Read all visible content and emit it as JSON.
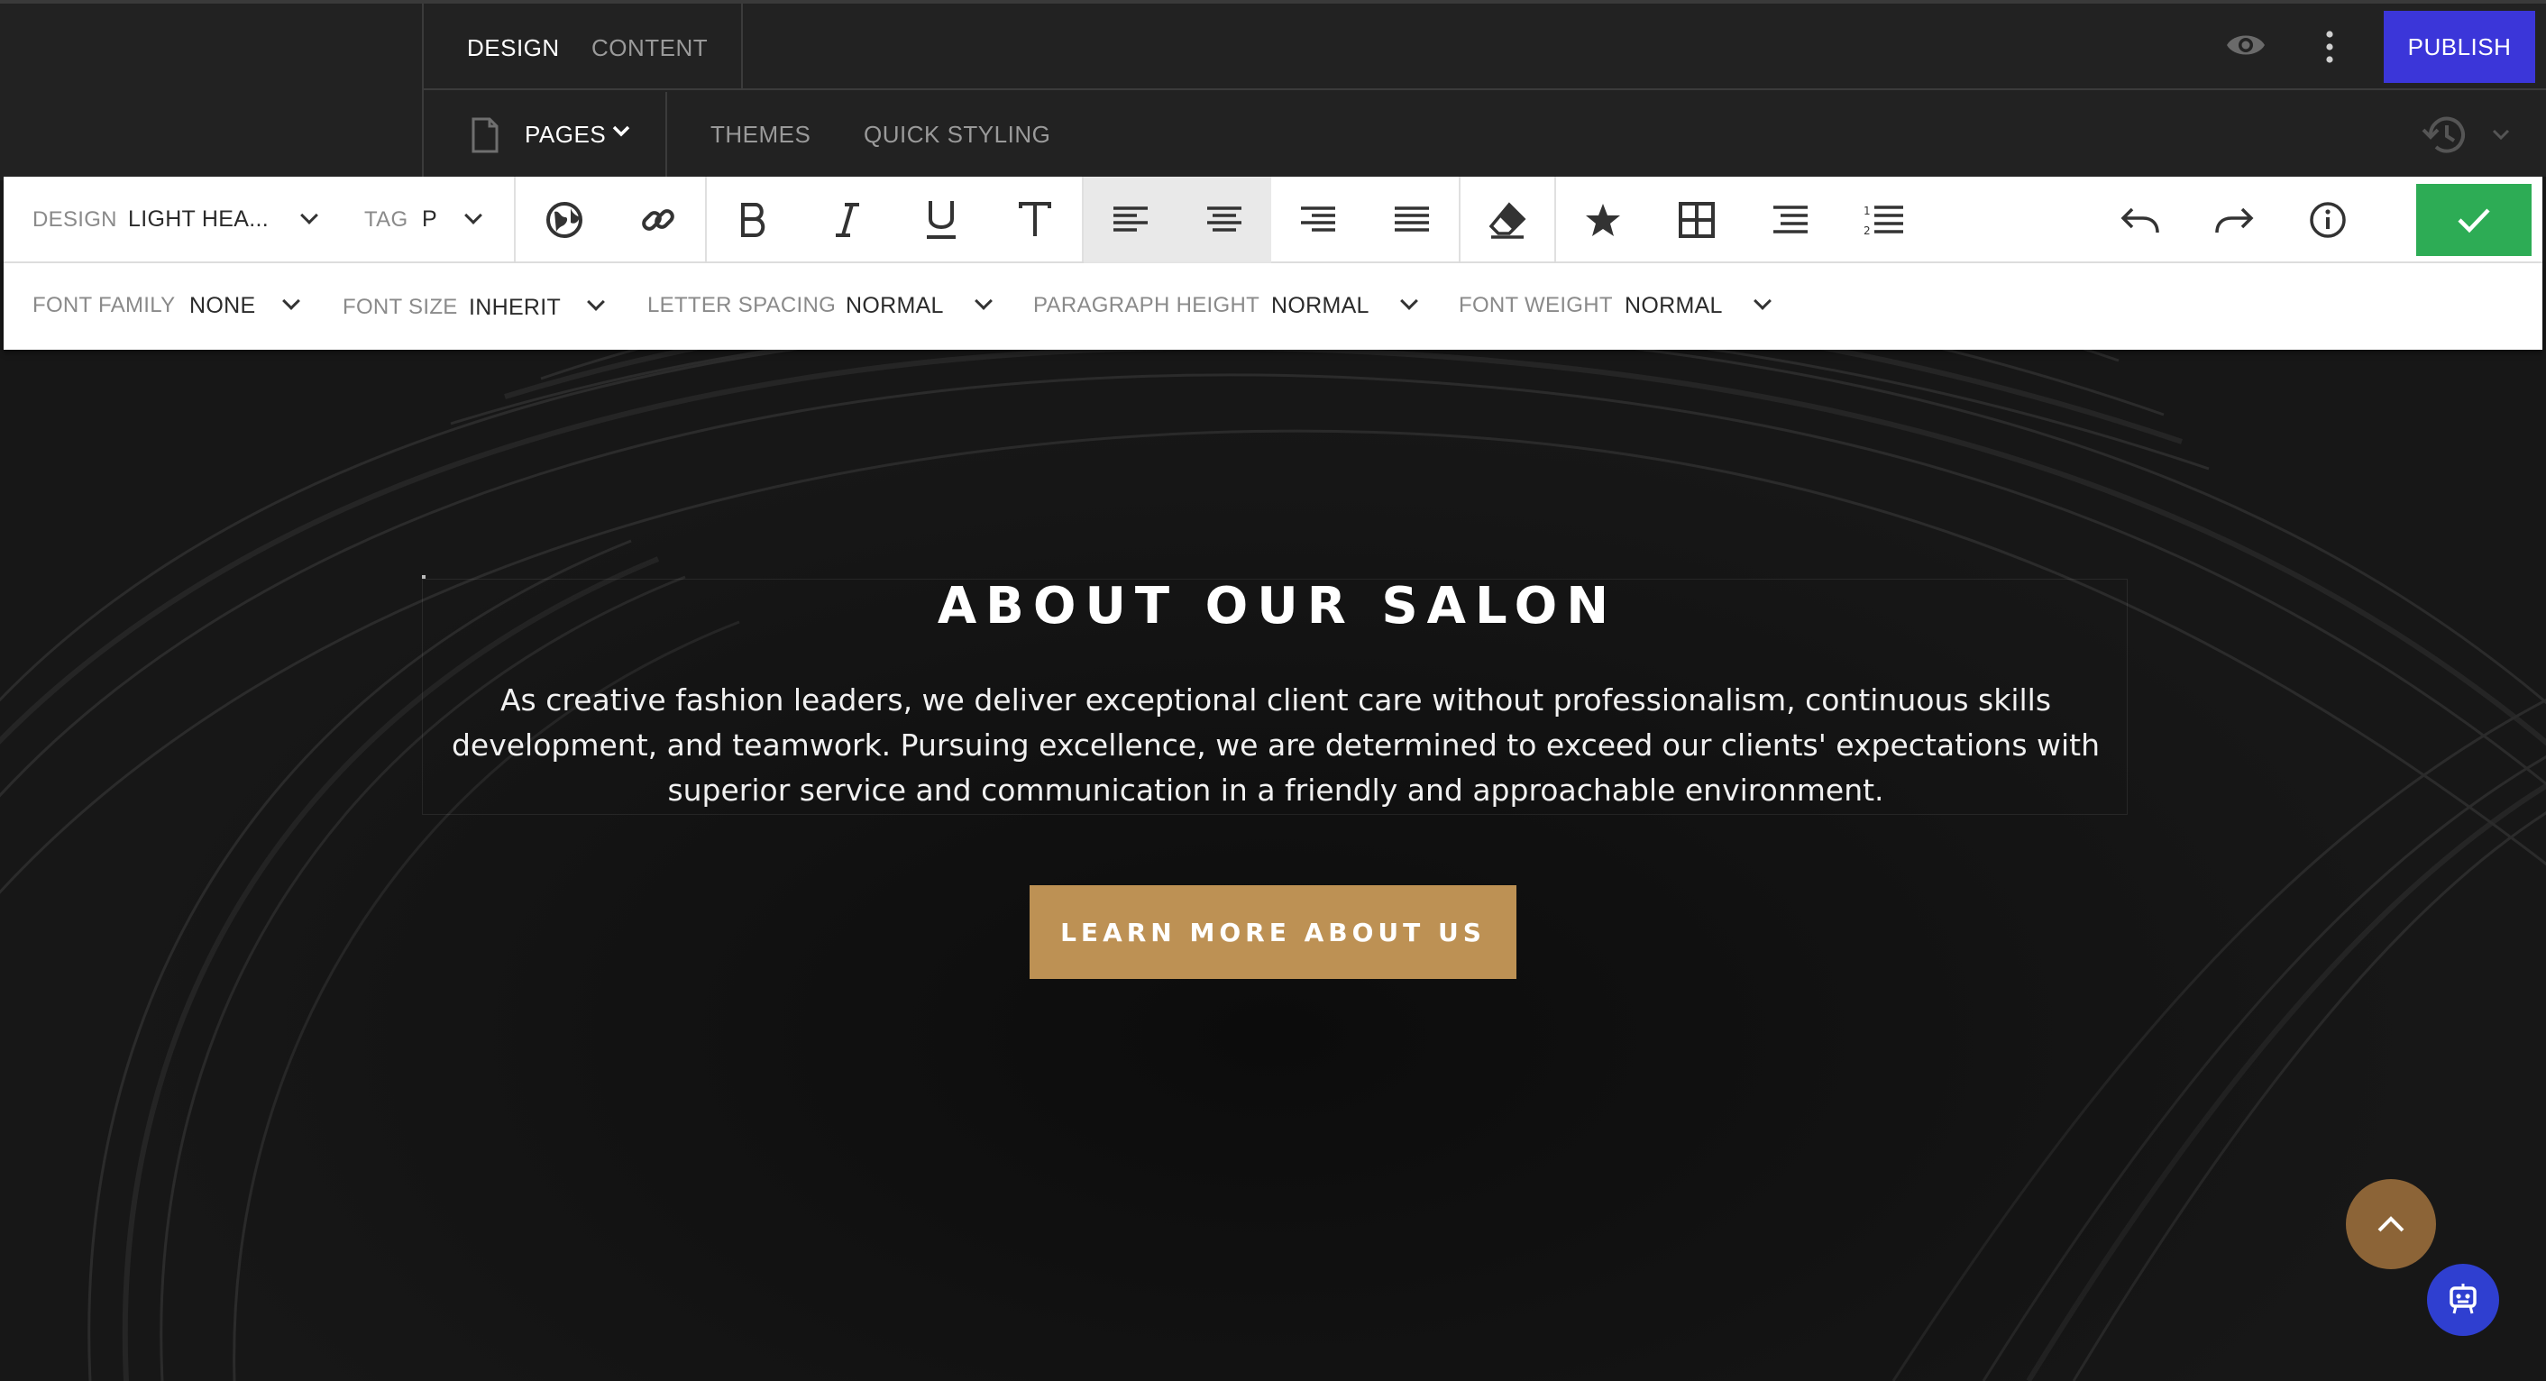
{
  "topbar": {
    "tabs": [
      {
        "label": "DESIGN",
        "active": true
      },
      {
        "label": "CONTENT",
        "active": false
      }
    ],
    "publish_label": "PUBLISH",
    "nav": {
      "pages_label": "PAGES",
      "themes_label": "THEMES",
      "quick_styling_label": "QUICK STYLING"
    }
  },
  "toolbar": {
    "design_label": "DESIGN",
    "design_value": "LIGHT HEA...",
    "tag_label": "TAG",
    "tag_value": "P",
    "buttons": [
      "globe-icon",
      "link-icon",
      "bold-icon",
      "italic-icon",
      "underline-icon",
      "text-type-icon",
      "align-left-icon",
      "align-center-icon",
      "align-right-icon",
      "align-justify-icon",
      "eraser-icon",
      "star-icon",
      "table-icon",
      "bullet-list-icon",
      "numbered-list-icon",
      "undo-icon",
      "redo-icon",
      "info-icon",
      "checkmark-icon"
    ],
    "selected_button": "align-center-icon"
  },
  "stylebar": {
    "font_family_label": "FONT FAMILY",
    "font_family_value": "NONE",
    "font_size_label": "FONT SIZE",
    "font_size_value": "INHERIT",
    "letter_spacing_label": "LETTER SPACING",
    "letter_spacing_value": "NORMAL",
    "paragraph_height_label": "PARAGRAPH HEIGHT",
    "paragraph_height_value": "NORMAL",
    "font_weight_label": "FONT WEIGHT",
    "font_weight_value": "NORMAL"
  },
  "hero": {
    "heading": "ABOUT OUR SALON",
    "paragraph": "As creative fashion leaders, we deliver exceptional client care without professionalism, continuous skills development, and teamwork. Pursuing excellence, we are determined to exceed our clients' expectations with superior service and communication in a friendly and approachable environment.",
    "cta_label": "LEARN MORE ABOUT US"
  },
  "colors": {
    "publish": "#3b36d9",
    "confirm": "#2dac55",
    "cta": "#bd9154",
    "scroll_top": "#8c6437",
    "helper": "#2f3fd0"
  }
}
